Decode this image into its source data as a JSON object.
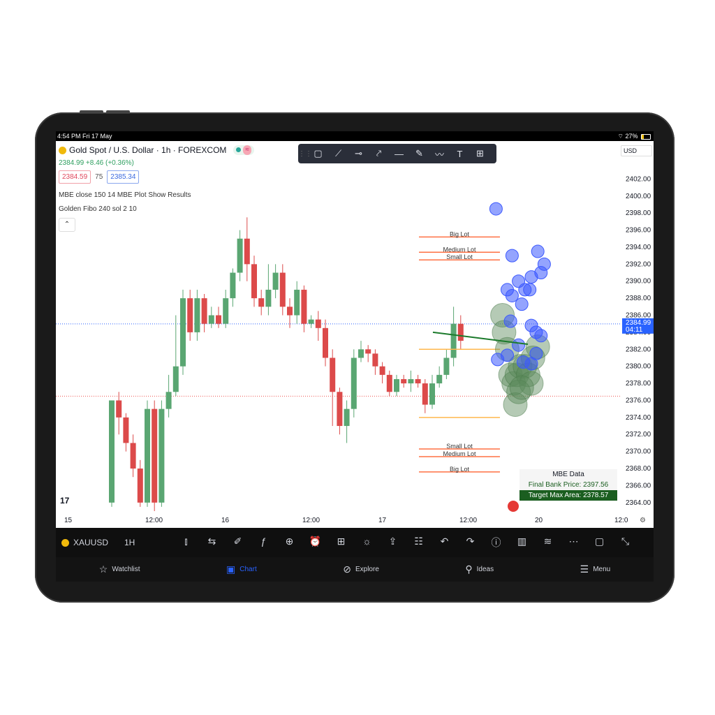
{
  "status": {
    "time": "4:54 PM  Fri 17 May",
    "battery": "27%"
  },
  "header": {
    "symbol_title": "Gold Spot / U.S. Dollar · 1h · FOREXCOM",
    "price_change": "2384.99 +8.46 (+0.36%)",
    "bid": "2384.59",
    "spread": "75",
    "ask": "2385.34",
    "currency": "USD"
  },
  "indicators": [
    "MBE close 150 14 MBE Plot Show Results",
    "Golden Fibo 240 sol 2 10"
  ],
  "drawing_toolbar": [
    "rectangle-icon",
    "trend-line-icon",
    "horizontal-ray-icon",
    "path-icon",
    "horizontal-line-icon",
    "brush-icon",
    "polyline-icon",
    "text-icon",
    "measure-icon"
  ],
  "mbe_data": {
    "title": "MBE Data",
    "final_bank": "Final Bank Price: 2397.56",
    "target": "Target Max Area: 2378.57"
  },
  "bottom_toolbar": {
    "symbol": "XAUUSD",
    "timeframe": "1H"
  },
  "nav": [
    {
      "label": "Watchlist",
      "icon": "star-icon"
    },
    {
      "label": "Chart",
      "icon": "chart-icon"
    },
    {
      "label": "Explore",
      "icon": "compass-icon"
    },
    {
      "label": "Ideas",
      "icon": "lightbulb-icon"
    },
    {
      "label": "Menu",
      "icon": "menu-icon"
    }
  ],
  "colors": {
    "up": "#26a69a",
    "down": "#ef5350",
    "accent": "#2962ff",
    "bubble_blue": "#3d5afe",
    "bubble_green": "#5a8a5a"
  },
  "chart_data": {
    "type": "candlestick",
    "title": "Gold Spot / U.S. Dollar · 1h · FOREXCOM",
    "ylim": [
      2363,
      2404
    ],
    "y_ticks": [
      2364,
      2366,
      2368,
      2370,
      2372,
      2374,
      2376,
      2378,
      2380,
      2382,
      2384,
      2386,
      2388,
      2390,
      2392,
      2394,
      2396,
      2398,
      2400,
      2402
    ],
    "x_ticks": [
      "15",
      "12:00",
      "16",
      "12:00",
      "17",
      "12:00",
      "20",
      "12:0"
    ],
    "last_price": "2384.99",
    "countdown": "04:11",
    "candles": [
      [
        2364,
        2376,
        2363.5,
        2376
      ],
      [
        2376,
        2374,
        2372,
        2377
      ],
      [
        2374,
        2371,
        2370,
        2374.5
      ],
      [
        2371,
        2368,
        2367,
        2372
      ],
      [
        2368,
        2364,
        2363.5,
        2369
      ],
      [
        2364,
        2375,
        2363.5,
        2376
      ],
      [
        2375,
        2364,
        2363,
        2376
      ],
      [
        2364,
        2375,
        2363.5,
        2376
      ],
      [
        2375,
        2377,
        2374,
        2379
      ],
      [
        2377,
        2380,
        2376.5,
        2386
      ],
      [
        2380,
        2388,
        2379,
        2389
      ],
      [
        2388,
        2384,
        2383,
        2389
      ],
      [
        2384,
        2388,
        2383,
        2389
      ],
      [
        2388,
        2385,
        2384,
        2388.5
      ],
      [
        2385,
        2386,
        2384.5,
        2387
      ],
      [
        2386,
        2385,
        2384.5,
        2387
      ],
      [
        2385,
        2388,
        2384.5,
        2389
      ],
      [
        2388,
        2391,
        2387,
        2391.5
      ],
      [
        2391,
        2395,
        2390,
        2396
      ],
      [
        2395,
        2392,
        2390,
        2397.5
      ],
      [
        2392,
        2388,
        2387,
        2393
      ],
      [
        2388,
        2387,
        2386,
        2389
      ],
      [
        2387,
        2389,
        2386,
        2392
      ],
      [
        2389,
        2391,
        2388,
        2392
      ],
      [
        2391,
        2387,
        2386,
        2392
      ],
      [
        2387,
        2386,
        2384.5,
        2388
      ],
      [
        2386,
        2389,
        2385,
        2390
      ],
      [
        2389,
        2385,
        2384,
        2389.5
      ],
      [
        2385,
        2385.5,
        2384.5,
        2386
      ],
      [
        2385.5,
        2384.5,
        2383,
        2386.5
      ],
      [
        2384.5,
        2381,
        2380,
        2385.5
      ],
      [
        2381,
        2377,
        2373,
        2382
      ],
      [
        2377,
        2373,
        2372,
        2377.5
      ],
      [
        2373,
        2375,
        2371,
        2376
      ],
      [
        2375,
        2381,
        2374,
        2382
      ],
      [
        2381,
        2382,
        2380.5,
        2383
      ],
      [
        2382,
        2381.5,
        2380.5,
        2382.5
      ],
      [
        2381.5,
        2380,
        2379,
        2382
      ],
      [
        2380,
        2379,
        2378,
        2380.5
      ],
      [
        2379,
        2377,
        2376.5,
        2379.5
      ],
      [
        2377,
        2378.5,
        2376.5,
        2379
      ],
      [
        2378.5,
        2378,
        2377.5,
        2379
      ],
      [
        2378,
        2378.5,
        2377,
        2379.5
      ],
      [
        2378.5,
        2378,
        2377.5,
        2379
      ],
      [
        2378,
        2375.5,
        2374.5,
        2378.5
      ],
      [
        2375.5,
        2378,
        2375,
        2379
      ],
      [
        2378,
        2379,
        2377.5,
        2380
      ],
      [
        2379,
        2381,
        2378.5,
        2382
      ],
      [
        2381,
        2385,
        2380,
        2387
      ],
      [
        2385,
        2383,
        2382,
        2386
      ]
    ],
    "fibo_levels": [
      {
        "label": "Big Lot",
        "value": 2395.2
      },
      {
        "label": "Medium Lot",
        "value": 2393.4
      },
      {
        "label": "Small Lot",
        "value": 2392.5
      },
      {
        "label": "Small Lot",
        "value": 2370.3
      },
      {
        "label": "Medium Lot",
        "value": 2369.4
      },
      {
        "label": "Big Lot",
        "value": 2367.6
      }
    ],
    "yellow_levels": [
      2382.0,
      2374.0
    ],
    "red_dotted_level": 2376.5,
    "trend_line": {
      "from": [
        2384.0
      ],
      "to": [
        2382.6
      ]
    },
    "blue_bubbles": [
      [
        48,
        2398.5
      ],
      [
        58,
        2393
      ],
      [
        78,
        2392
      ],
      [
        76,
        2391
      ],
      [
        74,
        2393.5
      ],
      [
        70,
        2390.5
      ],
      [
        62,
        2390
      ],
      [
        55,
        2389
      ],
      [
        58,
        2388.3
      ],
      [
        66,
        2389
      ],
      [
        69,
        2389
      ],
      [
        64,
        2387.3
      ],
      [
        57,
        2385.3
      ],
      [
        70,
        2384.8
      ],
      [
        73,
        2384
      ],
      [
        62,
        2382.5
      ],
      [
        55,
        2381.3
      ],
      [
        49,
        2380.8
      ],
      [
        65,
        2380.5
      ],
      [
        70,
        2380.3
      ],
      [
        73,
        2381.5
      ],
      [
        76,
        2383.6
      ]
    ],
    "green_bubbles": [
      [
        52,
        2386
      ],
      [
        53,
        2384
      ],
      [
        55,
        2382
      ],
      [
        57,
        2379
      ],
      [
        59,
        2378
      ],
      [
        61,
        2379
      ],
      [
        63,
        2380
      ],
      [
        66,
        2380
      ],
      [
        68,
        2379
      ],
      [
        70,
        2378
      ],
      [
        62,
        2377
      ],
      [
        60,
        2375.5
      ],
      [
        64,
        2377.5
      ],
      [
        74,
        2382.3
      ],
      [
        71,
        2381
      ]
    ]
  }
}
